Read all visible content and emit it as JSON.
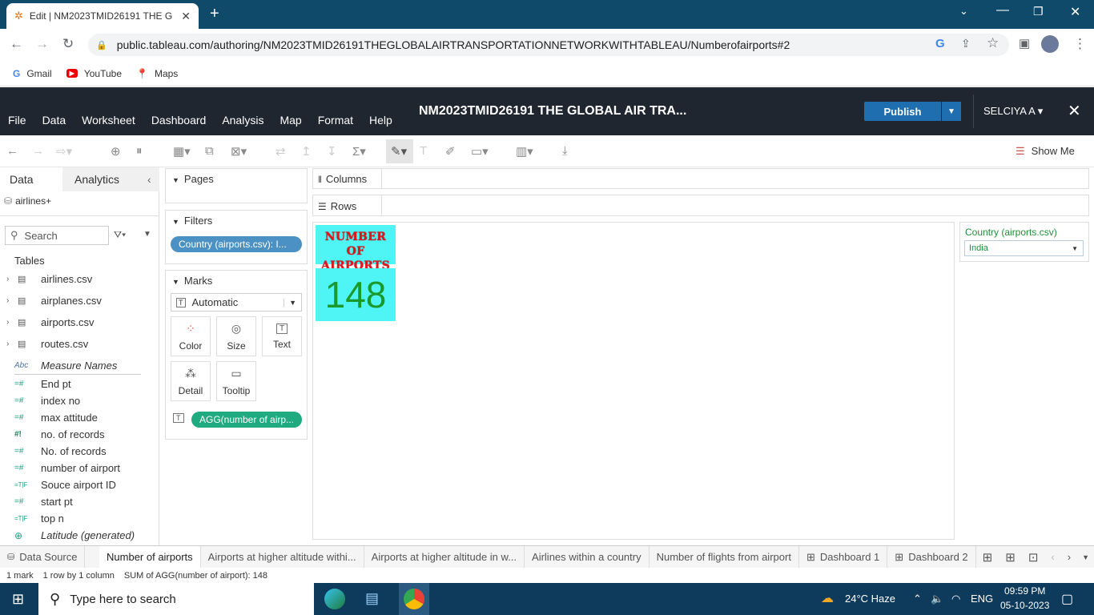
{
  "browser": {
    "tab_title": "Edit | NM2023TMID26191 THE G",
    "url": "public.tableau.com/authoring/NM2023TMID26191THEGLOBALAIRTRANSPORTATIONNETWORKWITHTABLEAU/Numberofairports#2",
    "bookmarks": [
      "Gmail",
      "YouTube",
      "Maps"
    ]
  },
  "tableau": {
    "menus": [
      "File",
      "Data",
      "Worksheet",
      "Dashboard",
      "Analysis",
      "Map",
      "Format",
      "Help"
    ],
    "workbook_title": "NM2023TMID26191 THE GLOBAL AIR TRA...",
    "publish_label": "Publish",
    "user": "SELCIYA A",
    "show_me": "Show Me"
  },
  "data_pane": {
    "tabs": [
      "Data",
      "Analytics"
    ],
    "datasource": "airlines+",
    "search_placeholder": "Search",
    "tables_header": "Tables",
    "tables": [
      "airlines.csv",
      "airplanes.csv",
      "airports.csv",
      "routes.csv"
    ],
    "fields": [
      {
        "type": "Abc",
        "name": "Measure Names"
      },
      {
        "type": "=#",
        "name": "End pt"
      },
      {
        "type": "=#",
        "name": "index no"
      },
      {
        "type": "=#",
        "name": "max attitude"
      },
      {
        "type": "#!",
        "name": "no. of records"
      },
      {
        "type": "=#",
        "name": "No. of records"
      },
      {
        "type": "=#",
        "name": "number of airport"
      },
      {
        "type": "=T|F",
        "name": "Souce airport ID"
      },
      {
        "type": "=#",
        "name": "start pt"
      },
      {
        "type": "=T|F",
        "name": "top n"
      },
      {
        "type": "globe",
        "name": "Latitude (generated)"
      }
    ]
  },
  "shelves": {
    "pages": "Pages",
    "filters": "Filters",
    "filter_pill": "Country (airports.csv): I...",
    "marks": "Marks",
    "mark_type": "Automatic",
    "mark_buttons": [
      "Color",
      "Size",
      "Text",
      "Detail",
      "Tooltip"
    ],
    "marks_pill": "AGG(number of airp...",
    "columns": "Columns",
    "rows": "Rows"
  },
  "view": {
    "title_line1": "NUMBER OF",
    "title_line2": "AIRPORTS",
    "value": "148"
  },
  "filter_card": {
    "label": "Country (airports.csv)",
    "selected": "India"
  },
  "sheet_tabs": [
    "Data Source",
    "Number of airports",
    "Airports at higher altitude withi...",
    "Airports at higher altitude in w...",
    "Airlines within a country",
    "Number of flights from airport",
    "Dashboard 1",
    "Dashboard 2"
  ],
  "status": {
    "marks": "1 mark",
    "dims": "1 row by 1 column",
    "sum": "SUM of AGG(number of airport): 148"
  },
  "taskbar": {
    "search_placeholder": "Type here to search",
    "weather": "24°C  Haze",
    "lang": "ENG",
    "time": "09:59 PM",
    "date": "05-10-2023"
  },
  "colors": {
    "tableau_header": "#1f2630",
    "publish": "#1f6fb0",
    "kpi_bg": "#4ff5f5",
    "kpi_title": "#e3141b",
    "kpi_value": "#1a9a2a",
    "filter_pill": "#4b91c4",
    "measure_pill": "#1fab7f"
  }
}
